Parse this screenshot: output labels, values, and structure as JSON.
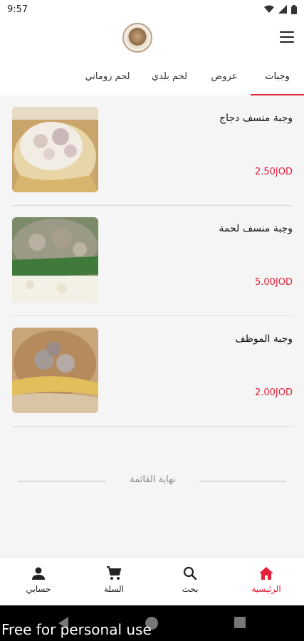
{
  "status_bar": {
    "time": "9:57"
  },
  "tabs": [
    {
      "label": "وجبات",
      "active": true
    },
    {
      "label": "عروض",
      "active": false
    },
    {
      "label": "لحم بلدي",
      "active": false
    },
    {
      "label": "لحم روماني",
      "active": false
    }
  ],
  "meals": [
    {
      "name": "وجبة منسف دجاج",
      "price": "2.50JOD"
    },
    {
      "name": "وجبة منسف لحمة",
      "price": "5.00JOD"
    },
    {
      "name": "وجبة الموظف",
      "price": "2.00JOD"
    }
  ],
  "list_end_text": "نهاية القائمة",
  "bottom_nav": {
    "home": "الرئيسية",
    "search": "بحث",
    "cart": "السلة",
    "account": "حسابي"
  },
  "watermark": "Free for personal use",
  "colors": {
    "accent": "#e5203a",
    "background": "#f5f5f5"
  }
}
